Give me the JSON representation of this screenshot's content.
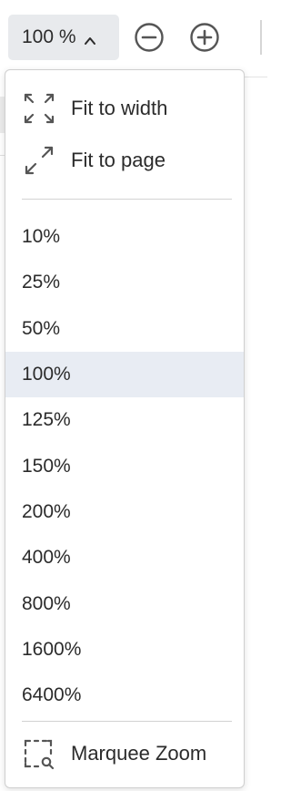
{
  "toolbar": {
    "zoom_value": "100 %",
    "zoom_out_icon": "minus-circle-icon",
    "zoom_in_icon": "plus-circle-icon"
  },
  "menu": {
    "fit_width_label": "Fit to width",
    "fit_width_icon": "fit-width-icon",
    "fit_page_label": "Fit to page",
    "fit_page_icon": "fit-page-icon",
    "levels": [
      "10%",
      "25%",
      "50%",
      "100%",
      "125%",
      "150%",
      "200%",
      "400%",
      "800%",
      "1600%",
      "6400%"
    ],
    "selected_level": "100%",
    "marquee_label": "Marquee Zoom",
    "marquee_icon": "marquee-zoom-icon"
  },
  "colors": {
    "select_bg": "#e8eaed",
    "selected_row_bg": "#e8ecf3",
    "icon_color": "#555555",
    "text_color": "#2b2b2b"
  }
}
